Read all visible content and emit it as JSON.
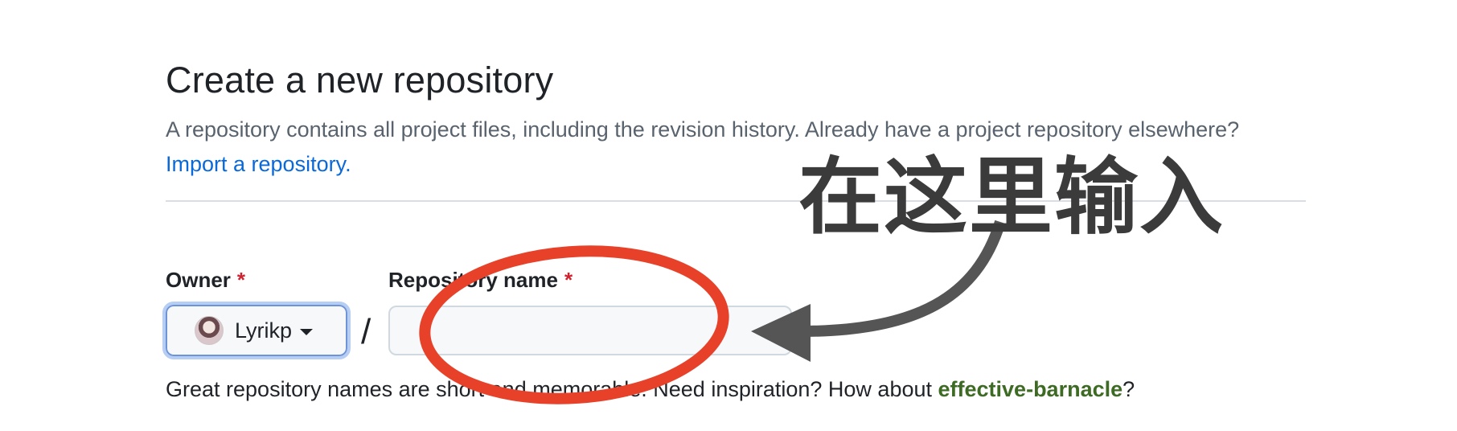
{
  "header": {
    "title": "Create a new repository",
    "description": "A repository contains all project files, including the revision history. Already have a project repository elsewhere?",
    "import_link": "Import a repository."
  },
  "form": {
    "owner_label": "Owner",
    "repo_label": "Repository name",
    "required_marker": "*",
    "owner_value": "Lyrikp",
    "separator": "/",
    "repo_value": "",
    "hint_prefix": "Great repository names are short and memorable. Need inspiration? How about",
    "suggestion": "effective-barnacle",
    "hint_suffix": "?"
  },
  "annotation": {
    "text": "在这里输入",
    "circle_color": "#e8412a",
    "arrow_color": "#555555"
  },
  "colors": {
    "link": "#0969da",
    "required": "#cf222e",
    "suggestion": "#3d6b23"
  }
}
